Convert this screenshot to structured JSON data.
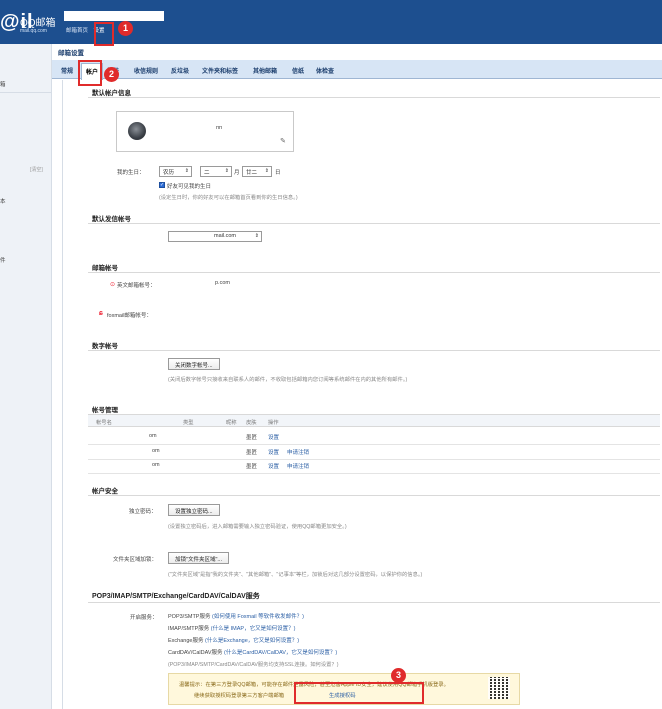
{
  "header": {
    "logo_mark": "@il",
    "logo_name": "QQ邮箱",
    "logo_sub": "mail.qq.com",
    "links": [
      "邮箱首页",
      "设置"
    ]
  },
  "sidebar": {
    "items": [
      "箱",
      "",
      "",
      "[清空]",
      "本",
      "",
      "件"
    ]
  },
  "page_title": "邮箱设置",
  "tabs": [
    "常规",
    "帐户",
    "换肤",
    "收信规则",
    "反垃圾",
    "文件夹和标签",
    "其他邮箱",
    "信纸",
    "体检查"
  ],
  "default_account": {
    "title": "默认帐户信息",
    "nickname_suffix": "пп",
    "birthday_label": "我的生日：",
    "calendar": "农历",
    "month_value": "二",
    "month_unit": "月",
    "day_value": "廿二",
    "day_unit": "日",
    "friends_visible": "好友可见我的生日",
    "birthday_note": "(设定生日时，你的好友可以在邮箱首页看到你的生日信息。)"
  },
  "default_sender": {
    "title": "默认发信帐号",
    "value": "mail.com"
  },
  "mailbox_accounts": {
    "title": "邮箱帐号",
    "english_label": "英文邮箱帐号：",
    "english_value": "p.com",
    "foxmail_label": "foxmail邮箱帐号："
  },
  "digital_account": {
    "title": "数字帐号",
    "button": "关闭数字帐号...",
    "note": "(关闭后数字帐号只接收来自联系人的邮件，不收取包括邮箱内您订阅等系统邮件在内的其他所有邮件。)"
  },
  "account_mgmt": {
    "title": "帐号管理",
    "headers": [
      "帐号名",
      "类型",
      "昵称",
      "皮肤",
      "操作"
    ],
    "rows": [
      {
        "name_suffix": "om",
        "type": "",
        "skin": "墨匠",
        "actions": [
          "设置"
        ]
      },
      {
        "name_suffix": "om",
        "type": "",
        "skin": "墨匠",
        "actions": [
          "设置",
          "申请注销"
        ]
      },
      {
        "name_suffix": "om",
        "type": "",
        "skin": "墨匠",
        "actions": [
          "设置",
          "申请注销"
        ]
      }
    ]
  },
  "security": {
    "title": "帐户安全",
    "pwd_label": "独立密码：",
    "pwd_button": "设置独立密码...",
    "pwd_note": "(设置独立密码后，进入邮箱需要输入独立密码验证，使用QQ邮箱更加安全。)",
    "folder_label": "文件夹区域加锁：",
    "folder_button": "加锁\"文件夹区域\"...",
    "folder_note": "(\"文件夹区域\"是指\"我的文件夹\"、\"其他邮箱\"、\"记事本\"等栏，加锁后对这几部分设置密码，以保护你的信息。)"
  },
  "pop3": {
    "title": "POP3/IMAP/SMTP/Exchange/CardDAV/CalDAV服务",
    "enable_label": "开启服务：",
    "services": [
      {
        "name": "POP3/SMTP服务",
        "hint": "(如何使用 Foxmail 等软件收发邮件？)"
      },
      {
        "name": "IMAP/SMTP服务",
        "hint": "(什么是 IMAP，它又是如何设置？)"
      },
      {
        "name": "Exchange服务",
        "hint": "(什么是Exchange，它又是如何设置？)"
      },
      {
        "name": "CardDAV/CalDAV服务",
        "hint": "(什么是CardDAV/CalDAV，它又是如何设置？)"
      }
    ],
    "ssl_note": "(POP3/IMAP/SMTP/CardDAV/CalDAV服务均支持SSL连接。如何设置？)",
    "tip_line1_a": "温馨提示：在第三方登录QQ邮箱，可能存在邮件泄露风险，甚至危害Apple ID安全，建议使用QQ邮箱手机版登录。",
    "tip_line2_a": "继续获取授权码登录第三方客户端邮箱",
    "tip_line2_b": "生成授权码"
  },
  "annotations": [
    "1",
    "2",
    "3"
  ]
}
